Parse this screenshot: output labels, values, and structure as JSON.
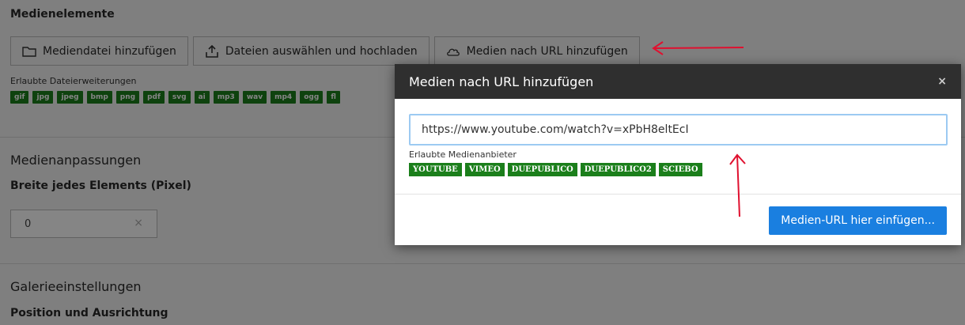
{
  "media": {
    "heading": "Medienelemente",
    "buttons": {
      "add_file": "Mediendatei hinzufügen",
      "upload": "Dateien auswählen und hochladen",
      "add_url": "Medien nach URL hinzufügen"
    },
    "allowed_ext_label": "Erlaubte Dateierweiterungen",
    "extensions": [
      "gif",
      "jpg",
      "jpeg",
      "bmp",
      "png",
      "pdf",
      "svg",
      "ai",
      "mp3",
      "wav",
      "mp4",
      "ogg",
      "fl"
    ]
  },
  "adjustments": {
    "heading": "Medienanpassungen",
    "width_label": "Breite jedes Elements (Pixel)",
    "width_value": "0",
    "clear_symbol": "×"
  },
  "gallery": {
    "heading": "Galerieeinstellungen",
    "position_label": "Position und Ausrichtung"
  },
  "modal": {
    "title": "Medien nach URL hinzufügen",
    "close": "×",
    "url_value": "https://www.youtube.com/watch?v=xPbH8eltEcI",
    "providers_label": "Erlaubte Medienanbieter",
    "providers": [
      "YOUTUBE",
      "VIMEO",
      "DUEPUBLICO",
      "DUEPUBLICO2",
      "SCIEBO"
    ],
    "submit": "Medien-URL hier einfügen..."
  },
  "colors": {
    "badge_green": "#1b7f1b",
    "primary_blue": "#1a7fe0",
    "annotation_red": "#e0102f"
  }
}
